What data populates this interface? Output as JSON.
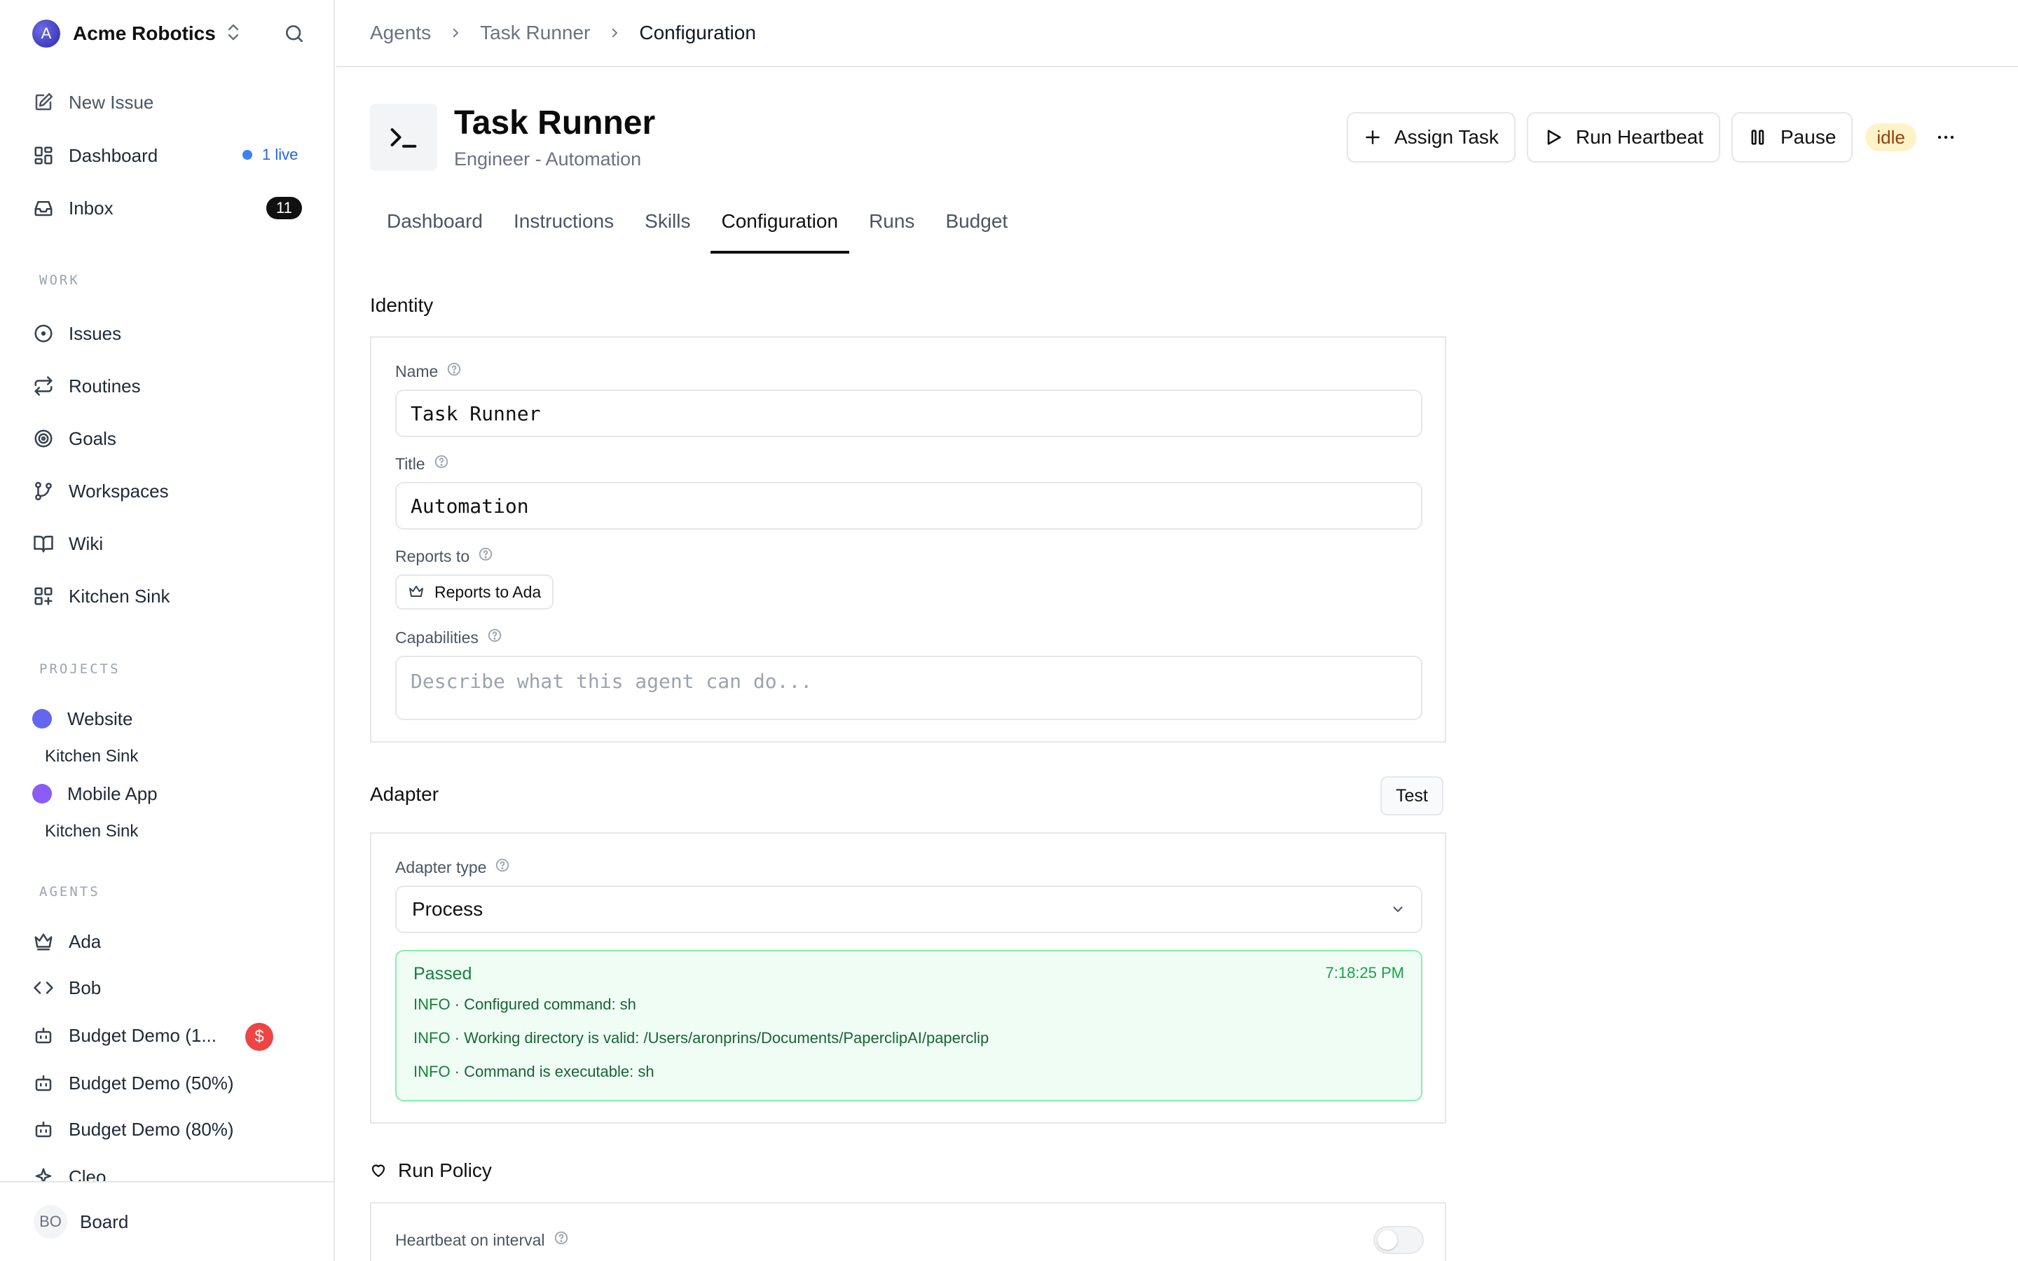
{
  "sidebar": {
    "org": {
      "initial": "A",
      "name": "Acme Robotics"
    },
    "top_items": [
      {
        "label": "New Issue",
        "icon": "edit-icon"
      },
      {
        "label": "Dashboard",
        "icon": "dashboard-icon",
        "badge": "1 live"
      },
      {
        "label": "Inbox",
        "icon": "inbox-icon",
        "count": "11"
      }
    ],
    "sections": {
      "work": "WORK",
      "projects": "PROJECTS",
      "agents": "AGENTS"
    },
    "work_items": [
      {
        "label": "Issues",
        "icon": "circle-dot-icon"
      },
      {
        "label": "Routines",
        "icon": "repeat-icon"
      },
      {
        "label": "Goals",
        "icon": "target-icon"
      },
      {
        "label": "Workspaces",
        "icon": "git-branch-icon"
      },
      {
        "label": "Wiki",
        "icon": "book-icon"
      },
      {
        "label": "Kitchen Sink",
        "icon": "grid-plus-icon"
      }
    ],
    "projects": [
      {
        "label": "Website",
        "color": "#6366f1",
        "sub": "Kitchen Sink"
      },
      {
        "label": "Mobile App",
        "color": "#8b5cf6",
        "sub": "Kitchen Sink"
      }
    ],
    "agents": [
      {
        "label": "Ada",
        "icon": "crown-icon"
      },
      {
        "label": "Bob",
        "icon": "code-icon"
      },
      {
        "label": "Budget Demo (1...",
        "icon": "bot-icon",
        "badge": "$"
      },
      {
        "label": "Budget Demo (50%)",
        "icon": "bot-icon"
      },
      {
        "label": "Budget Demo (80%)",
        "icon": "bot-icon"
      },
      {
        "label": "Cleo",
        "icon": "sparkle-icon"
      }
    ],
    "footer": {
      "initials": "BO",
      "label": "Board"
    }
  },
  "breadcrumb": [
    "Agents",
    "Task Runner",
    "Configuration"
  ],
  "agent": {
    "name": "Task Runner",
    "subtitle": "Engineer - Automation",
    "status": "idle"
  },
  "actions": {
    "assign": "Assign Task",
    "heartbeat": "Run Heartbeat",
    "pause": "Pause"
  },
  "tabs": [
    "Dashboard",
    "Instructions",
    "Skills",
    "Configuration",
    "Runs",
    "Budget"
  ],
  "identity": {
    "title": "Identity",
    "name_label": "Name",
    "name_value": "Task Runner",
    "title_label": "Title",
    "title_value": "Automation",
    "reports_label": "Reports to",
    "reports_value": "Reports to Ada",
    "capabilities_label": "Capabilities",
    "capabilities_placeholder": "Describe what this agent can do..."
  },
  "adapter": {
    "title": "Adapter",
    "test_label": "Test",
    "type_label": "Adapter type",
    "type_value": "Process",
    "result": {
      "status": "Passed",
      "time": "7:18:25 PM",
      "logs": [
        {
          "level": "INFO",
          "message": "Configured command: sh"
        },
        {
          "level": "INFO",
          "message": "Working directory is valid: /Users/aronprins/Documents/PaperclipAI/paperclip"
        },
        {
          "level": "INFO",
          "message": "Command is executable: sh"
        }
      ]
    }
  },
  "run_policy": {
    "title": "Run Policy",
    "heartbeat_label": "Heartbeat on interval"
  }
}
